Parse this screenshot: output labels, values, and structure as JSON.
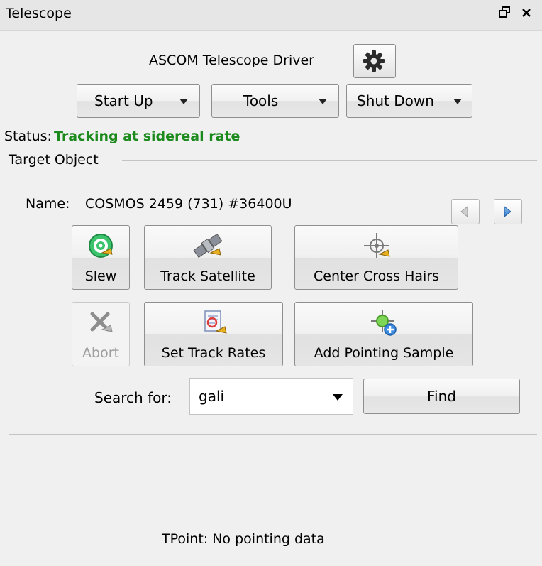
{
  "window": {
    "title": "Telescope",
    "float_icon": "restore-icon",
    "close_icon": "close-icon"
  },
  "driver": {
    "label": "ASCOM Telescope Driver",
    "settings_icon": "gear-icon"
  },
  "toolbar": {
    "startup_label": "Start Up",
    "tools_label": "Tools",
    "shutdown_label": "Shut Down"
  },
  "status": {
    "label": "Status:",
    "value": "Tracking at sidereal rate",
    "value_color": "#1c8a1c"
  },
  "target": {
    "group_label": "Target Object",
    "name_label": "Name:",
    "name_value": "COSMOS 2459 (731) #36400U",
    "prev_icon": "arrow-left-icon",
    "next_icon": "arrow-right-icon"
  },
  "actions": {
    "slew": "Slew",
    "track_satellite": "Track Satellite",
    "center_cross_hairs": "Center Cross Hairs",
    "abort": "Abort",
    "set_track_rates": "Set Track Rates",
    "add_pointing_sample": "Add Pointing Sample"
  },
  "search": {
    "label": "Search for:",
    "value": "gali",
    "find_label": "Find"
  },
  "tpoint": {
    "text": "TPoint: No pointing data"
  }
}
